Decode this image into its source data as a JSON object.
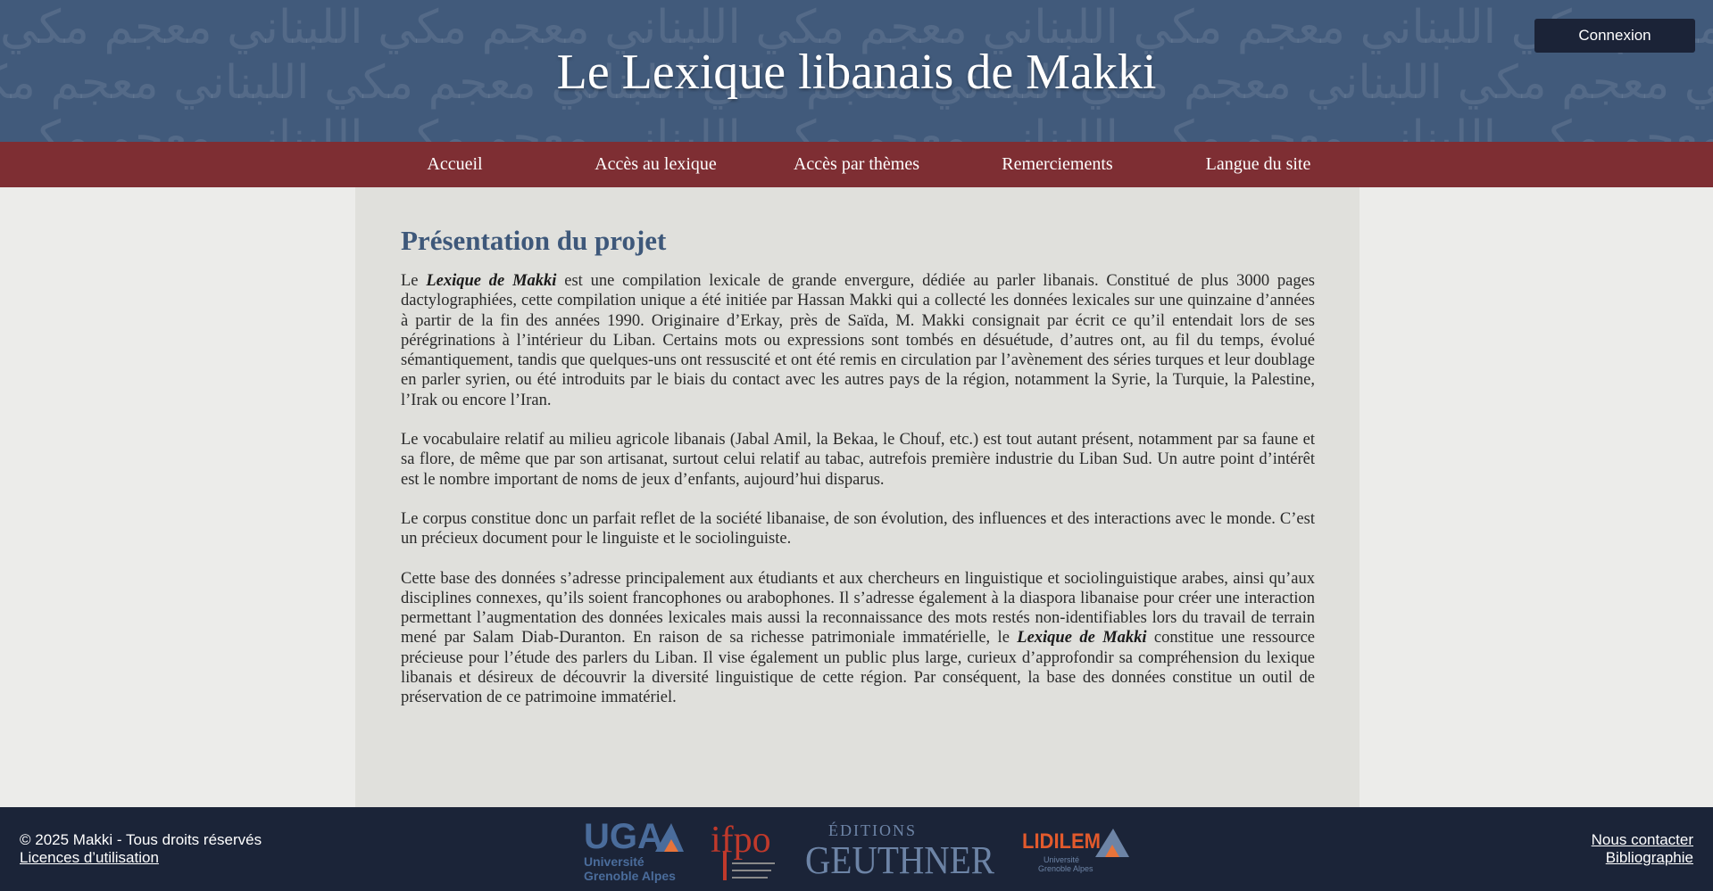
{
  "header": {
    "title": "Le Lexique libanais de Makki",
    "login_label": "Connexion",
    "pattern_row": "معجم مكي اللبناني معجم مكي اللبناني معجم مكي اللبناني معجم مكي اللبناني معجم مكي اللبناني معجم مكي اللبناني معجم مكي"
  },
  "nav": {
    "items": [
      "Accueil",
      "Accès au lexique",
      "Accès par thèmes",
      "Remerciements",
      "Langue du site"
    ]
  },
  "main": {
    "heading": "Présentation du projet",
    "p1_a": "Le ",
    "p1_em": "Lexique de Makki",
    "p1_b": " est une compilation lexicale de grande envergure, dédiée au parler libanais. Constitué de plus 3000 pages dactylographiées, cette compilation unique a été initiée par Hassan Makki qui a collecté les données lexicales sur une quinzaine d’années à partir de la fin des années 1990. Originaire d’Erkay, près de Saïda, M. Makki consignait par écrit ce qu’il entendait lors de ses pérégrinations à l’intérieur du Liban. Certains mots ou expressions sont tombés en désuétude, d’autres ont, au fil du temps, évolué sémantiquement, tandis que quelques-uns ont ressuscité et ont été remis en circulation par l’avènement des séries turques et leur doublage en parler syrien, ou été introduits par le biais du contact avec les autres pays de la région, notamment la Syrie, la Turquie, la Palestine, l’Irak ou encore l’Iran.",
    "p2": "Le vocabulaire relatif au milieu agricole libanais (Jabal Amil, la Bekaa, le Chouf, etc.) est tout autant présent, notamment par sa faune et sa flore, de même que par son artisanat, surtout celui relatif au tabac, autrefois première industrie du Liban Sud. Un autre point d’intérêt est le nombre important de noms de jeux d’enfants, aujourd’hui disparus.",
    "p3": "Le corpus constitue donc un parfait reflet de la société libanaise, de son évolution, des influences et des interactions avec le monde. C’est un précieux document pour le linguiste et le sociolinguiste.",
    "p4_a": "Cette base des données s’adresse principalement aux étudiants et aux chercheurs en linguistique et sociolinguistique arabes, ainsi qu’aux disciplines connexes, qu’ils soient francophones ou arabophones. Il s’adresse également à la diaspora libanaise pour créer une interaction permettant l’augmentation des données lexicales mais aussi la reconnaissance des mots restés non-identifiables lors du travail de terrain mené par Salam Diab-Duranton. En raison de sa richesse patrimoniale immatérielle, le ",
    "p4_em": "Lexique de Makki",
    "p4_b": " constitue une ressource précieuse pour l’étude des parlers du Liban. Il vise également un public plus large, curieux d’approfondir sa compréhension du lexique libanais et désireux de découvrir la diversité linguistique de cette région. Par conséquent, la base des données constitue un outil de préservation de ce patrimoine immatériel."
  },
  "footer": {
    "copyright": "© 2025 Makki - Tous droits réservés",
    "licences": "Licences d’utilisation",
    "contact": "Nous contacter",
    "bibliographie": "Bibliographie",
    "logos": {
      "uga_main": "UGA",
      "uga_sub1": "Université",
      "uga_sub2": "Grenoble Alpes",
      "ifpo": "ifpo",
      "geuthner_top": "ÉDITIONS",
      "geuthner_main": "GEUTHNER",
      "lidilem_main": "LIDILEM",
      "lidilem_sub1": "Université",
      "lidilem_sub2": "Grenoble Alpes"
    }
  },
  "colors": {
    "header_bg": "#415a7b",
    "nav_bg": "#7e2e33",
    "footer_bg": "#1b2438",
    "heading": "#3e587a",
    "uga_blue": "#4a6c9b",
    "uga_orange": "#e8743b",
    "ifpo_red": "#c0392b",
    "lidilem_orange": "#e35a2c"
  }
}
